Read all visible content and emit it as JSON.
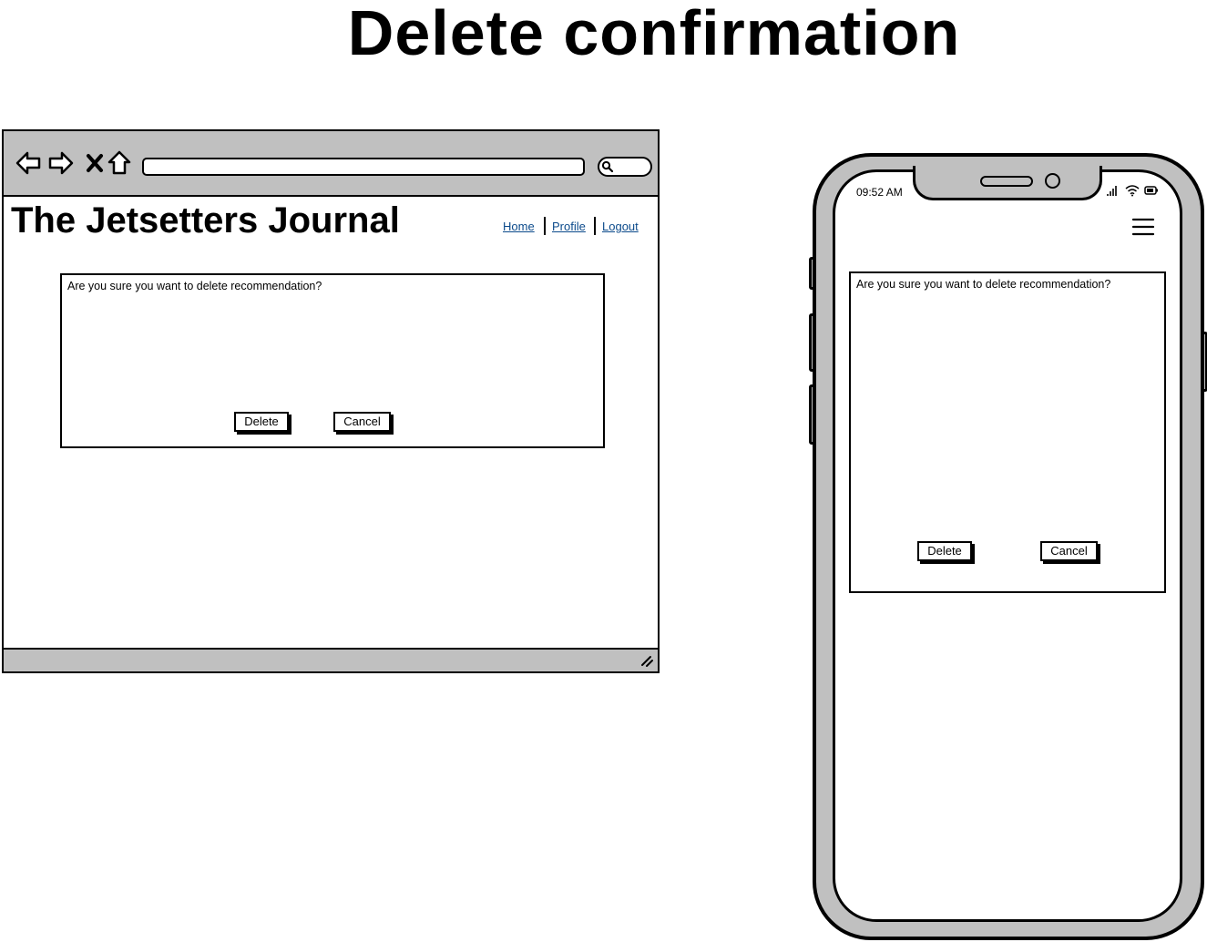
{
  "page": {
    "title": "Delete confirmation"
  },
  "desktop": {
    "site_title": "The Jetsetters Journal",
    "nav": {
      "home": "Home",
      "profile": "Profile",
      "logout": "Logout"
    },
    "dialog": {
      "message": "Are you sure you want to delete recommendation?",
      "delete_label": "Delete",
      "cancel_label": "Cancel"
    }
  },
  "mobile": {
    "status_time": "09:52 AM",
    "menu_icon": "hamburger-menu-icon",
    "dialog": {
      "message": "Are you sure you want to delete recommendation?",
      "delete_label": "Delete",
      "cancel_label": "Cancel"
    }
  },
  "colors": {
    "chrome_gray": "#c0c0c0",
    "link_blue": "#0b4a8b",
    "stroke": "#000000"
  }
}
